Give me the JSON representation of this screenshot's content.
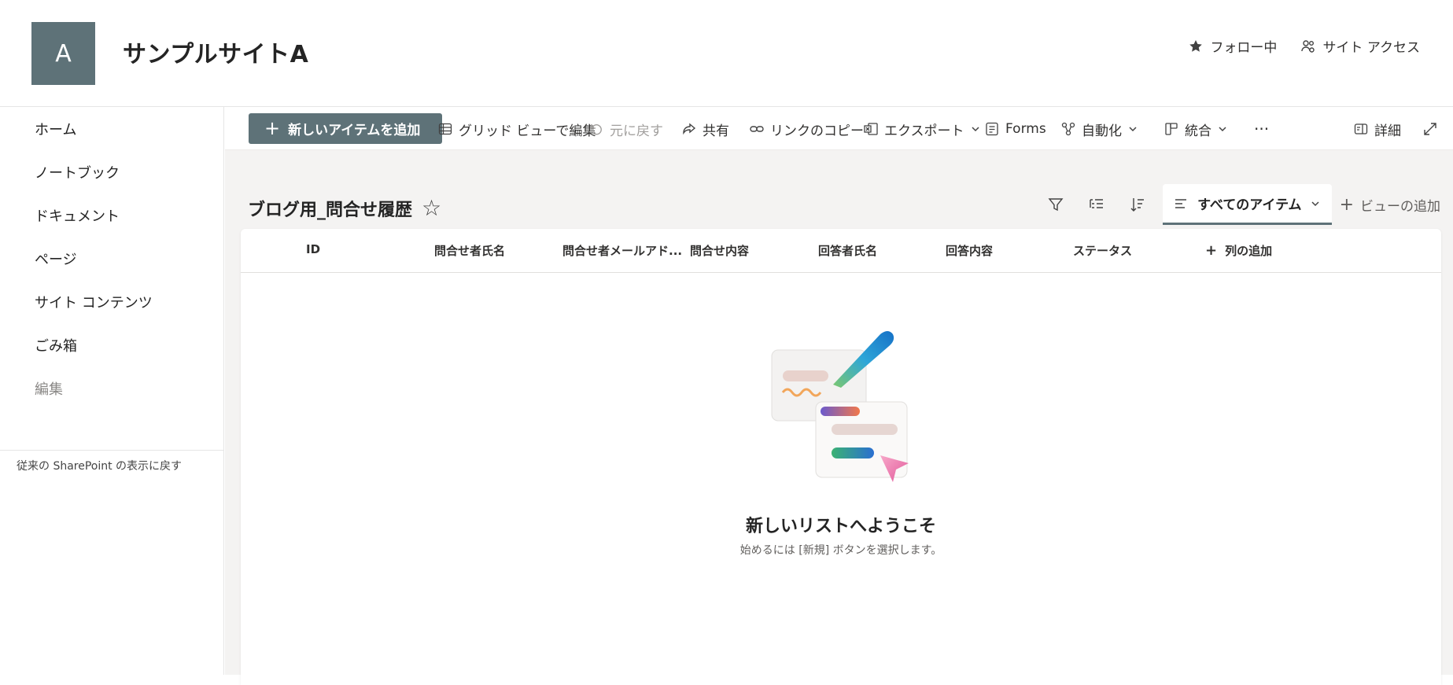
{
  "site": {
    "logo_letter": "A",
    "title": "サンプルサイトA",
    "follow_label": "フォロー中",
    "access_label": "サイト アクセス"
  },
  "nav": {
    "items": [
      "ホーム",
      "ノートブック",
      "ドキュメント",
      "ページ",
      "サイト コンテンツ",
      "ごみ箱"
    ],
    "edit_label": "編集",
    "classic_link": "従来の SharePoint の表示に戻す"
  },
  "commands": {
    "new_item": "新しいアイテムを追加",
    "grid_edit": "グリッド ビューで編集",
    "undo": "元に戻す",
    "share": "共有",
    "copy_link": "リンクのコピー",
    "export": "エクスポート",
    "forms": "Forms",
    "automate": "自動化",
    "integrate": "統合",
    "more": "···",
    "details": "詳細"
  },
  "list": {
    "title": "ブログ用_問合せ履歴",
    "view_name": "すべてのアイテム",
    "add_view": "ビューの追加",
    "columns": [
      "ID",
      "問合せ者氏名",
      "問合せ者メールアド...",
      "問合せ内容",
      "回答者氏名",
      "回答内容",
      "ステータス"
    ],
    "add_column": "列の追加",
    "empty_title": "新しいリストへようこそ",
    "empty_subtitle": "始めるには [新規] ボタンを選択します。"
  },
  "colors": {
    "accent": "#5e7278",
    "page_bg": "#f4f3f2"
  }
}
